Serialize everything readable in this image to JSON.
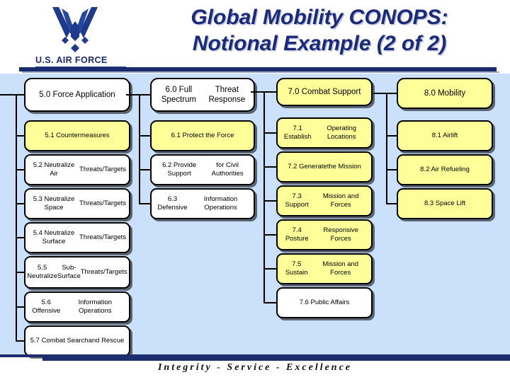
{
  "header": {
    "title": "Global Mobility CONOPS:\nNotional Example (2 of 2)",
    "title_line1": "Global Mobility CONOPS:",
    "title_line2": "Notional Example (2 of 2)",
    "logo_wordmark": "U.S. AIR FORCE",
    "logo_icon": "usaf-wing-logo"
  },
  "footer": {
    "motto": "Integrity - Service - Excellence"
  },
  "colors": {
    "canvas_background": "#CBE0FB",
    "highlight": "#FFFF99",
    "normal": "#FFFFFF",
    "navy": "#1B2A6B",
    "title_text": "#1A2A78",
    "line": "#000000"
  },
  "diagram": {
    "type": "hierarchy-columns",
    "columns": [
      {
        "id": "col-5",
        "head": {
          "label": "5.0 Force Application",
          "highlighted": false
        },
        "children": [
          {
            "label": "5.1 Countermeasures",
            "highlighted": true
          },
          {
            "label": "5.2 Neutralize Air\nThreats/Targets",
            "highlighted": false
          },
          {
            "label": "5.3 Neutralize Space\nThreats/Targets",
            "highlighted": false
          },
          {
            "label": "5.4 Neutralize Surface\nThreats/Targets",
            "highlighted": false
          },
          {
            "label": "5.5 Neutralize\nSub-Surface\nThreats/Targets",
            "highlighted": false
          },
          {
            "label": "5.6 Offensive\nInformation Operations",
            "highlighted": false
          },
          {
            "label": "5.7 Combat Search\nand Rescue",
            "highlighted": false
          }
        ]
      },
      {
        "id": "col-6",
        "head": {
          "label": "6.0 Full Spectrum\nThreat Response",
          "highlighted": false
        },
        "children": [
          {
            "label": "6.1 Protect the Force",
            "highlighted": true
          },
          {
            "label": "6.2 Provide Support\nfor Civil Authorities",
            "highlighted": false
          },
          {
            "label": "6.3  Defensive\nInformation Operations",
            "highlighted": false
          }
        ]
      },
      {
        "id": "col-7",
        "head": {
          "label": "7.0 Combat Support",
          "highlighted": true
        },
        "children": [
          {
            "label": "7.1 Establish\nOperating Locations",
            "highlighted": true
          },
          {
            "label": "7.2 Generate\nthe Mission",
            "highlighted": true
          },
          {
            "label": "7.3 Support\nMission and Forces",
            "highlighted": true
          },
          {
            "label": "7.4 Posture\nResponsive Forces",
            "highlighted": true
          },
          {
            "label": "7.5 Sustain\nMission and Forces",
            "highlighted": true
          },
          {
            "label": "7.6 Public Affairs",
            "highlighted": false
          }
        ]
      },
      {
        "id": "col-8",
        "head": {
          "label": "8.0 Mobility",
          "highlighted": true
        },
        "children": [
          {
            "label": "8.1 Airlift",
            "highlighted": true
          },
          {
            "label": "8.2 Air Refueling",
            "highlighted": true
          },
          {
            "label": "8.3 Space Lift",
            "highlighted": true
          }
        ]
      }
    ]
  }
}
